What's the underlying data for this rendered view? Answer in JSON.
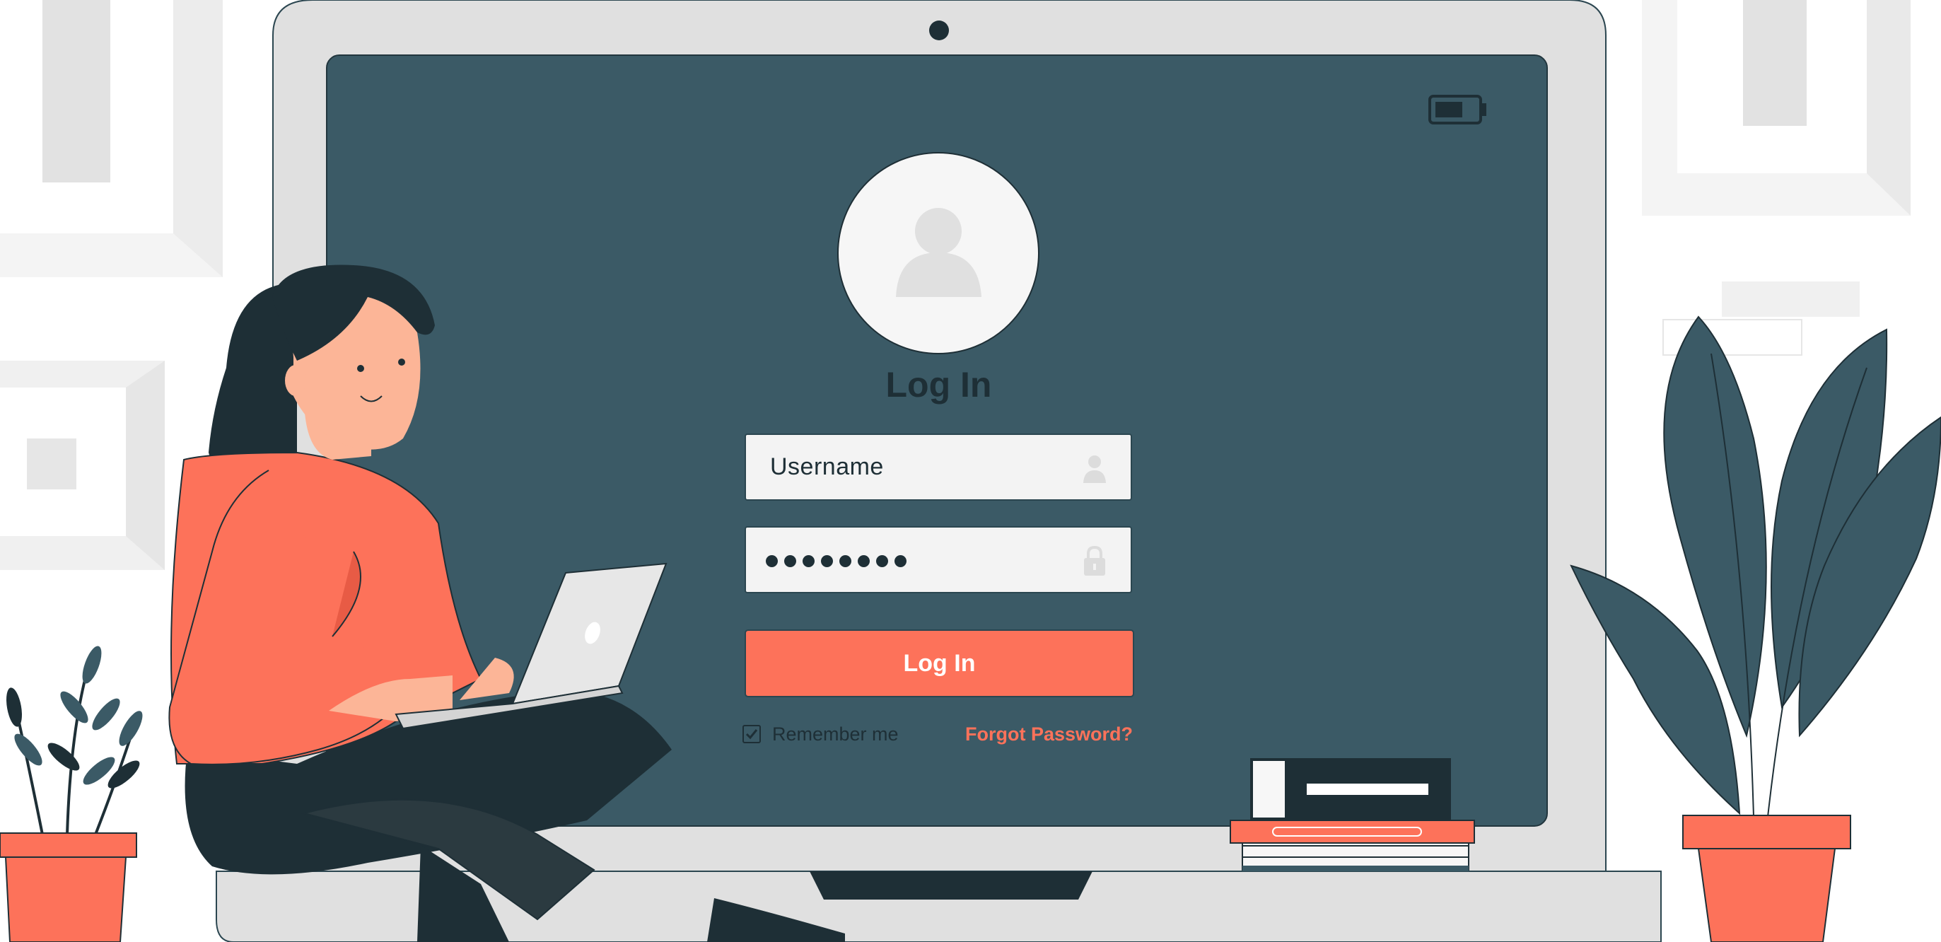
{
  "login": {
    "title": "Log In",
    "username_placeholder": "Username",
    "password_dots": 8,
    "button_label": "Log In",
    "remember_label": "Remember me",
    "remember_checked": true,
    "forgot_label": "Forgot Password?"
  },
  "colors": {
    "screen": "#3b5a66",
    "accent": "#fd725a",
    "dark": "#1e2f36",
    "laptop": "#e0e0e0"
  },
  "icons": [
    "battery-icon",
    "webcam-icon",
    "avatar-icon",
    "user-icon",
    "lock-icon",
    "check-icon"
  ]
}
